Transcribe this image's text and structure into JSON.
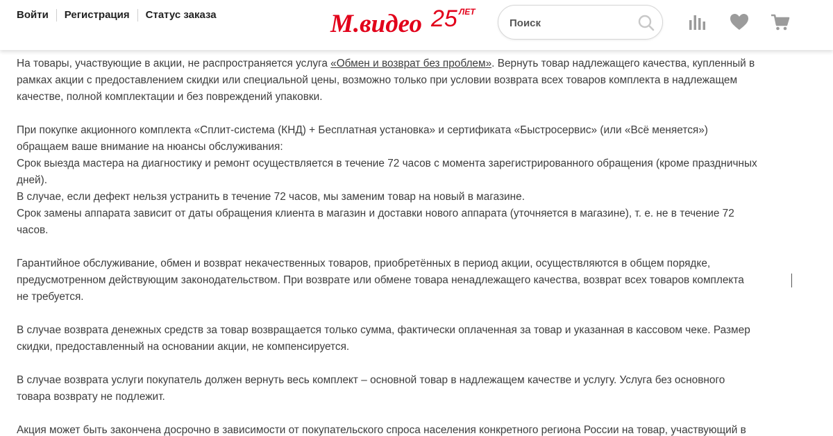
{
  "header": {
    "nav": {
      "login": "Войти",
      "register": "Регистрация",
      "order_status": "Статус заказа"
    },
    "logo": {
      "brand": "М.видео",
      "anniversary_number": "25",
      "anniversary_word": "ЛЕТ"
    },
    "search": {
      "placeholder": "Поиск",
      "value": ""
    },
    "icons": [
      "compare-icon",
      "heart-icon",
      "cart-icon"
    ]
  },
  "colors": {
    "brand_red": "#e2001a",
    "text": "#3d3d3d",
    "icon_gray": "#9b9b9b"
  },
  "content": {
    "p1": {
      "l1_pre": "На товары, участвующие в акции, не распространяется услуга ",
      "l1_link": "«Обмен и возврат без проблем»",
      "l1_post": ". Вернуть товар надлежащего качества, купленный в",
      "l2": "рамках акции с предоставлением скидки или специальной цены, возможно только при условии возврата всех товаров комплекта в надлежащем",
      "l3": "качестве, полной комплектации и без повреждений упаковки."
    },
    "p2": {
      "l1": "При покупке акционного комплекта «Сплит-система (КНД) + Бесплатная установка» и сертификата «Быстросервис» (или «Всё меняется»)",
      "l2": "обращаем ваше внимание на нюансы обслуживания:",
      "l3": "Срок выезда мастера на диагностику и ремонт осуществляется в течение 72 часов с момента зарегистрированного обращения (кроме праздничных",
      "l4": "дней).",
      "l5": "В случае, если дефект нельзя устранить в течение 72 часов, мы заменим товар на новый в магазине.",
      "l6": "Срок замены аппарата зависит от даты обращения клиента в магазин и доставки нового аппарата (уточняется в магазине), т. е. не в течение 72",
      "l7": "часов."
    },
    "p3": {
      "l1": "Гарантийное обслуживание, обмен и возврат некачественных товаров, приобретённых в период акции, осуществляются в общем порядке,",
      "l2": "предусмотренном действующим законодательством. При возврате или обмене товара ненадлежащего качества, возврат всех товаров комплекта",
      "l3": "не требуется."
    },
    "p4": {
      "l1": "В случае возврата денежных средств за товар возвращается только сумма, фактически оплаченная за товар и указанная в кассовом чеке. Размер",
      "l2": "скидки, предоставленный на основании акции, не компенсируется."
    },
    "p5": {
      "l1": "В случае возврата услуги покупатель должен вернуть весь комплект – основной товар в надлежащем качестве и услугу. Услуга без основного",
      "l2": "товара возврату не подлежит."
    },
    "p6": {
      "l1": "Акция может быть закончена досрочно в зависимости от покупательского спроса населения конкретного региона России на товар, участвующий в"
    }
  }
}
